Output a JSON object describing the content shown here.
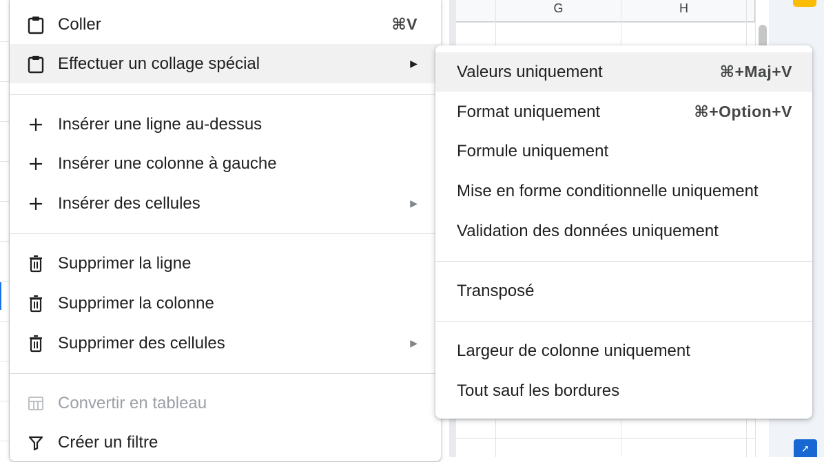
{
  "sheet": {
    "columns": [
      "G",
      "H"
    ]
  },
  "context_menu": {
    "items": [
      {
        "label": "Coller",
        "icon": "clipboard-icon",
        "shortcut": "⌘V"
      },
      {
        "label": "Effectuer un collage spécial",
        "icon": "clipboard-icon",
        "submenu_arrow": "▶"
      },
      {
        "label": "Insérer une ligne au-dessus",
        "icon": "plus-icon"
      },
      {
        "label": "Insérer une colonne à gauche",
        "icon": "plus-icon"
      },
      {
        "label": "Insérer des cellules",
        "icon": "plus-icon",
        "submenu_arrow": "▶"
      },
      {
        "label": "Supprimer la ligne",
        "icon": "trash-icon"
      },
      {
        "label": "Supprimer la colonne",
        "icon": "trash-icon"
      },
      {
        "label": "Supprimer des cellules",
        "icon": "trash-icon",
        "submenu_arrow": "▶"
      },
      {
        "label": "Convertir en tableau",
        "icon": "table-icon",
        "disabled": true
      },
      {
        "label": "Créer un filtre",
        "icon": "filter-icon"
      }
    ]
  },
  "paste_special_submenu": {
    "items": [
      {
        "label": "Valeurs uniquement",
        "shortcut": "⌘+Maj+V"
      },
      {
        "label": "Format uniquement",
        "shortcut": "⌘+Option+V"
      },
      {
        "label": "Formule uniquement"
      },
      {
        "label": "Mise en forme conditionnelle uniquement"
      },
      {
        "label": "Validation des données uniquement"
      },
      {
        "label": "Transposé"
      },
      {
        "label": "Largeur de colonne uniquement"
      },
      {
        "label": "Tout sauf les bordures"
      }
    ]
  },
  "colors": {
    "hover_bg": "#f1f1f1",
    "disabled_text": "#9aa0a6",
    "accent_blue": "#1a73e8",
    "side_yellow": "#fbbc04"
  }
}
